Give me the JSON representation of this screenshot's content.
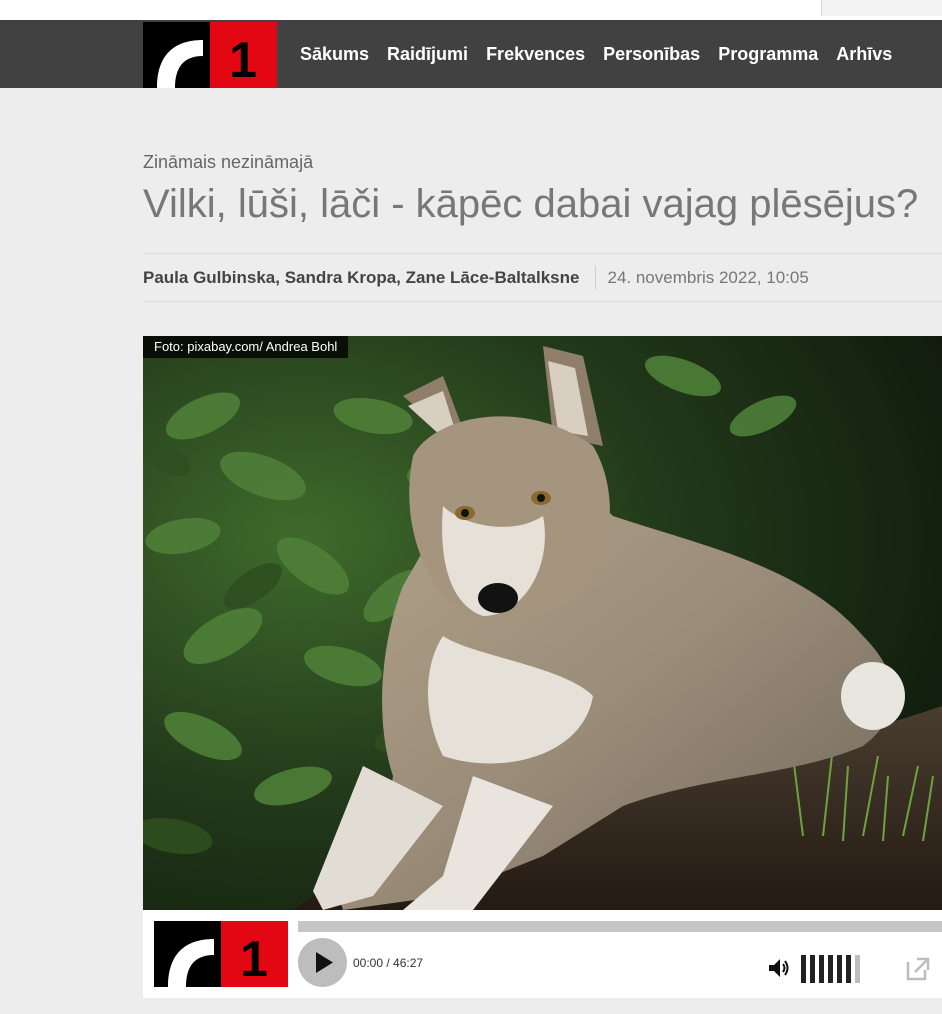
{
  "nav": {
    "logo_text": "1",
    "items": [
      {
        "label": "Sākums"
      },
      {
        "label": "Raidījumi"
      },
      {
        "label": "Frekvences"
      },
      {
        "label": "Personības"
      },
      {
        "label": "Programma"
      },
      {
        "label": "Arhīvs"
      }
    ]
  },
  "article": {
    "section": "Zināmais nezināmajā",
    "title": "Vilki, lūši, lāči - kāpēc dabai vajag plēsējus?",
    "authors": "Paula Gulbinska, Sandra Kropa, Zane Lāce-Baltalksne",
    "date": "24. novembris 2022, 10:05",
    "photo_credit": "Foto: pixabay.com/ Andrea Bohl"
  },
  "player": {
    "logo_text": "1",
    "time": "00:00 / 46:27",
    "progress": 0,
    "volume_level": 0.86
  },
  "icons": {
    "play": "play-icon",
    "volume": "speaker-icon",
    "popout": "external-link-icon"
  },
  "colors": {
    "brand_red": "#e30613",
    "nav_bg": "#414141",
    "accent_blue": "#3b8fd0"
  }
}
